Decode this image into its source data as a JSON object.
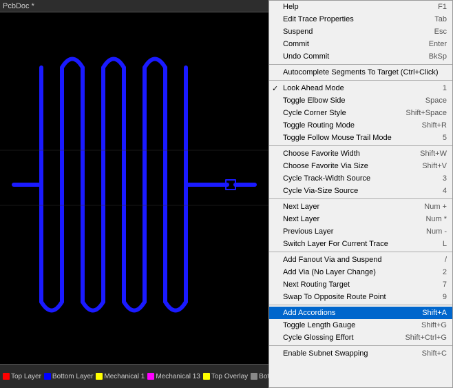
{
  "titleBar": {
    "label": "PcbDoc *"
  },
  "layerBar": {
    "items": [
      {
        "label": "Top Layer",
        "color": "#ff0000"
      },
      {
        "label": "Bottom Layer",
        "color": "#0000ff"
      },
      {
        "label": "Mechanical 1",
        "color": "#ffff00"
      },
      {
        "label": "Mechanical 13",
        "color": "#ff00ff"
      },
      {
        "label": "Top Overlay",
        "color": "#ffff00"
      },
      {
        "label": "Botto...",
        "color": "#888888"
      }
    ]
  },
  "contextMenu": {
    "items": [
      {
        "id": "help",
        "label": "Help",
        "shortcut": "F1",
        "separator": false,
        "checked": false,
        "highlighted": false
      },
      {
        "id": "edit-trace-props",
        "label": "Edit Trace Properties",
        "shortcut": "Tab",
        "separator": false,
        "checked": false,
        "highlighted": false
      },
      {
        "id": "suspend",
        "label": "Suspend",
        "shortcut": "Esc",
        "separator": false,
        "checked": false,
        "highlighted": false
      },
      {
        "id": "commit",
        "label": "Commit",
        "shortcut": "Enter",
        "separator": false,
        "checked": false,
        "highlighted": false
      },
      {
        "id": "undo-commit",
        "label": "Undo Commit",
        "shortcut": "BkSp",
        "separator": true,
        "checked": false,
        "highlighted": false
      },
      {
        "id": "autocomplete",
        "label": "Autocomplete Segments To Target (Ctrl+Click)",
        "shortcut": "",
        "separator": true,
        "checked": false,
        "highlighted": false
      },
      {
        "id": "look-ahead",
        "label": "Look Ahead Mode",
        "shortcut": "1",
        "separator": false,
        "checked": true,
        "highlighted": false
      },
      {
        "id": "toggle-elbow",
        "label": "Toggle Elbow Side",
        "shortcut": "Space",
        "separator": false,
        "checked": false,
        "highlighted": false
      },
      {
        "id": "cycle-corner",
        "label": "Cycle Corner Style",
        "shortcut": "Shift+Space",
        "separator": false,
        "checked": false,
        "highlighted": false
      },
      {
        "id": "toggle-routing",
        "label": "Toggle Routing Mode",
        "shortcut": "Shift+R",
        "separator": false,
        "checked": false,
        "highlighted": false
      },
      {
        "id": "toggle-follow",
        "label": "Toggle Follow Mouse Trail Mode",
        "shortcut": "5",
        "separator": true,
        "checked": false,
        "highlighted": false
      },
      {
        "id": "choose-width",
        "label": "Choose Favorite Width",
        "shortcut": "Shift+W",
        "separator": false,
        "checked": false,
        "highlighted": false
      },
      {
        "id": "choose-via",
        "label": "Choose Favorite Via Size",
        "shortcut": "Shift+V",
        "separator": false,
        "checked": false,
        "highlighted": false
      },
      {
        "id": "cycle-track",
        "label": "Cycle Track-Width Source",
        "shortcut": "3",
        "separator": false,
        "checked": false,
        "highlighted": false
      },
      {
        "id": "cycle-via",
        "label": "Cycle Via-Size Source",
        "shortcut": "4",
        "separator": true,
        "checked": false,
        "highlighted": false
      },
      {
        "id": "next-layer-plus",
        "label": "Next Layer",
        "shortcut": "Num +",
        "separator": false,
        "checked": false,
        "highlighted": false
      },
      {
        "id": "next-layer-star",
        "label": "Next Layer",
        "shortcut": "Num *",
        "separator": false,
        "checked": false,
        "highlighted": false
      },
      {
        "id": "prev-layer",
        "label": "Previous Layer",
        "shortcut": "Num -",
        "separator": false,
        "checked": false,
        "highlighted": false
      },
      {
        "id": "switch-layer",
        "label": "Switch Layer For Current Trace",
        "shortcut": "L",
        "separator": true,
        "checked": false,
        "highlighted": false
      },
      {
        "id": "add-fanout",
        "label": "Add Fanout Via and Suspend",
        "shortcut": "/",
        "separator": false,
        "checked": false,
        "highlighted": false
      },
      {
        "id": "add-via",
        "label": "Add Via (No Layer Change)",
        "shortcut": "2",
        "separator": false,
        "checked": false,
        "highlighted": false
      },
      {
        "id": "next-routing",
        "label": "Next Routing Target",
        "shortcut": "7",
        "separator": false,
        "checked": false,
        "highlighted": false
      },
      {
        "id": "swap-route",
        "label": "Swap To Opposite Route Point",
        "shortcut": "9",
        "separator": true,
        "checked": false,
        "highlighted": false
      },
      {
        "id": "add-accordions",
        "label": "Add Accordions",
        "shortcut": "Shift+A",
        "separator": false,
        "checked": false,
        "highlighted": true
      },
      {
        "id": "toggle-length",
        "label": "Toggle Length Gauge",
        "shortcut": "Shift+G",
        "separator": false,
        "checked": false,
        "highlighted": false
      },
      {
        "id": "cycle-gloss",
        "label": "Cycle Glossing Effort",
        "shortcut": "Shift+Ctrl+G",
        "separator": true,
        "checked": false,
        "highlighted": false
      },
      {
        "id": "enable-subnet",
        "label": "Enable Subnet Swapping",
        "shortcut": "Shift+C",
        "separator": false,
        "checked": false,
        "highlighted": false
      }
    ]
  }
}
